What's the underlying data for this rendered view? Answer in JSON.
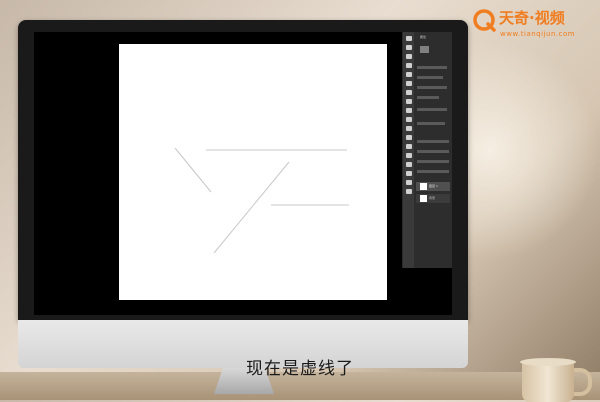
{
  "logo": {
    "brand": "天奇·视频",
    "url": "www.tianqijun.com",
    "accent": "#f07d1f"
  },
  "subtitle": "现在是虚线了",
  "photoshop": {
    "panel_title": "属性",
    "layers": [
      {
        "name": "图层 1",
        "active": true
      },
      {
        "name": "背景",
        "active": false
      }
    ]
  },
  "canvas": {
    "background": "#ffffff",
    "stroke_color": "#c8c8c8"
  }
}
